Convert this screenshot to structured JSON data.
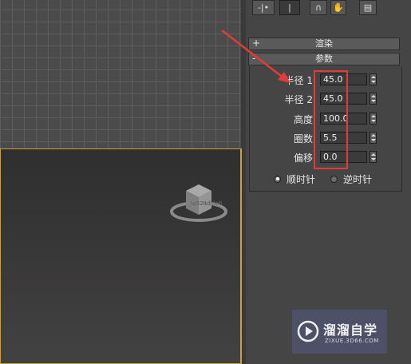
{
  "tabs": {
    "create": "-|•",
    "modify": "|",
    "hierarchy": "∩",
    "motion": "✋",
    "display": "▤"
  },
  "rollouts": {
    "render": {
      "sign": "+",
      "title": "渲染"
    },
    "params": {
      "sign": "-",
      "title": "参数"
    }
  },
  "parameters": [
    {
      "label": "半径 1:",
      "value": "45.0"
    },
    {
      "label": "半径 2:",
      "value": "45.0"
    },
    {
      "label": "高度:",
      "value": "100.0"
    },
    {
      "label": "圈数:",
      "value": "5.5"
    },
    {
      "label": "偏移:",
      "value": "0.0"
    }
  ],
  "direction": {
    "clockwise": "顺时针",
    "counterclockwise": "逆时针",
    "selected": "clockwise"
  },
  "watermark": {
    "brand": "溜溜自学",
    "url": "ZIXUE.3D66.COM"
  },
  "colors": {
    "highlight": "#e53a3a",
    "active_viewport_border": "#c9a13e",
    "watermark_bg": "#50526e"
  }
}
